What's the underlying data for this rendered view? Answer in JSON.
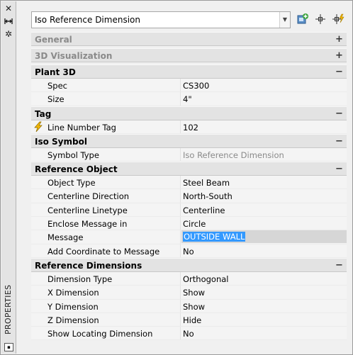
{
  "palette": {
    "title": "PROPERTIES",
    "icons": [
      "close-icon",
      "pin-icon",
      "settings-icon"
    ]
  },
  "selector": {
    "value": "Iso Reference Dimension",
    "tools": [
      "add-to-selection-icon",
      "pick-add-icon",
      "quick-select-icon"
    ]
  },
  "categories": [
    {
      "label": "General",
      "expanded": false,
      "toggle": "+",
      "props": []
    },
    {
      "label": "3D Visualization",
      "expanded": false,
      "toggle": "+",
      "props": []
    },
    {
      "label": "Plant 3D",
      "expanded": true,
      "toggle": "−",
      "props": [
        {
          "name": "Spec",
          "value": "CS300"
        },
        {
          "name": "Size",
          "value": "4\""
        }
      ]
    },
    {
      "label": "Tag",
      "expanded": true,
      "toggle": "−",
      "props": [
        {
          "name": "Line Number Tag",
          "value": "102",
          "icon": "lightning-bolt-icon"
        }
      ]
    },
    {
      "label": "Iso Symbol",
      "expanded": true,
      "toggle": "−",
      "props": [
        {
          "name": "Symbol Type",
          "value": "Iso Reference Dimension",
          "disabled": true
        }
      ]
    },
    {
      "label": "Reference Object",
      "expanded": true,
      "toggle": "−",
      "props": [
        {
          "name": "Object Type",
          "value": "Steel Beam"
        },
        {
          "name": "Centerline Direction",
          "value": "North-South"
        },
        {
          "name": "Centerline Linetype",
          "value": "Centerline"
        },
        {
          "name": "Enclose Message in",
          "value": "Circle"
        },
        {
          "name": "Message",
          "value": "OUTSIDE WALL",
          "active": true
        },
        {
          "name": "Add Coordinate to Message",
          "value": "No"
        }
      ]
    },
    {
      "label": "Reference Dimensions",
      "expanded": true,
      "toggle": "−",
      "props": [
        {
          "name": "Dimension Type",
          "value": "Orthogonal"
        },
        {
          "name": "X Dimension",
          "value": "Show"
        },
        {
          "name": "Y Dimension",
          "value": "Show"
        },
        {
          "name": "Z Dimension",
          "value": "Hide"
        },
        {
          "name": "Show Locating Dimension",
          "value": "No"
        }
      ]
    }
  ],
  "colors": {
    "highlight": "#3399ff",
    "category_bg": "#e3e3e3",
    "disabled_text": "#8a8a8a"
  }
}
